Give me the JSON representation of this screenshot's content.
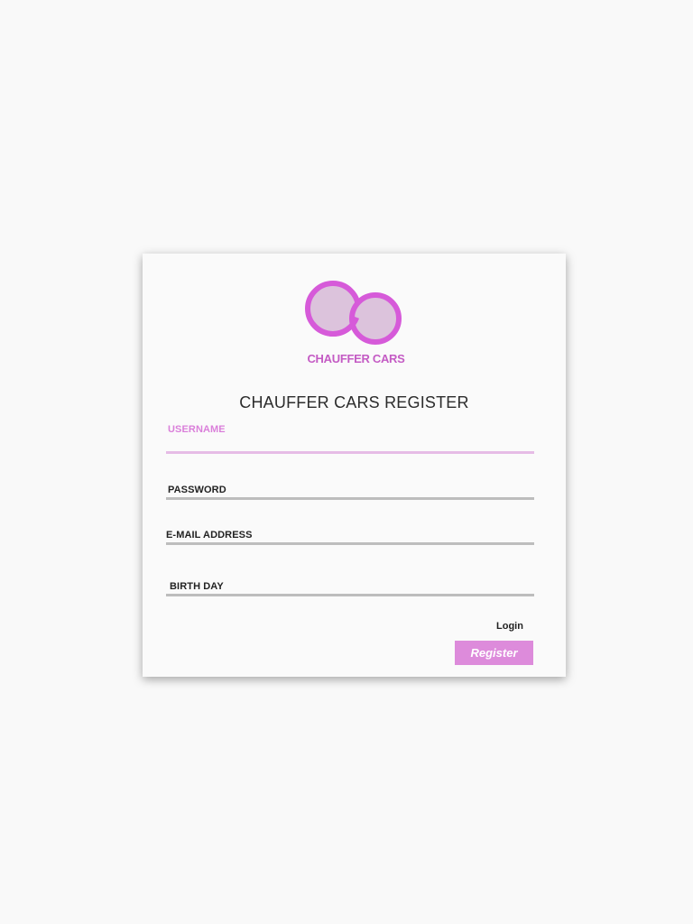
{
  "brand": {
    "logo_text": "CHAUFFER CARS",
    "logo_icon": "two-rings-logo-icon",
    "ring_color": "#d65ad9",
    "ring_fill": "#dcc3dc"
  },
  "form": {
    "title": "CHAUFFER CARS REGISTER",
    "fields": [
      {
        "label": "USERNAME",
        "value": ""
      },
      {
        "label": "PASSWORD",
        "value": ""
      },
      {
        "label": "E-MAIL ADDRESS",
        "value": ""
      },
      {
        "label": "BIRTH DAY",
        "value": ""
      }
    ],
    "login_label": "Login",
    "register_label": "Register"
  },
  "colors": {
    "accent": "#dd8bdb",
    "active_label": "#da7fda",
    "background": "#f9f9f9"
  }
}
